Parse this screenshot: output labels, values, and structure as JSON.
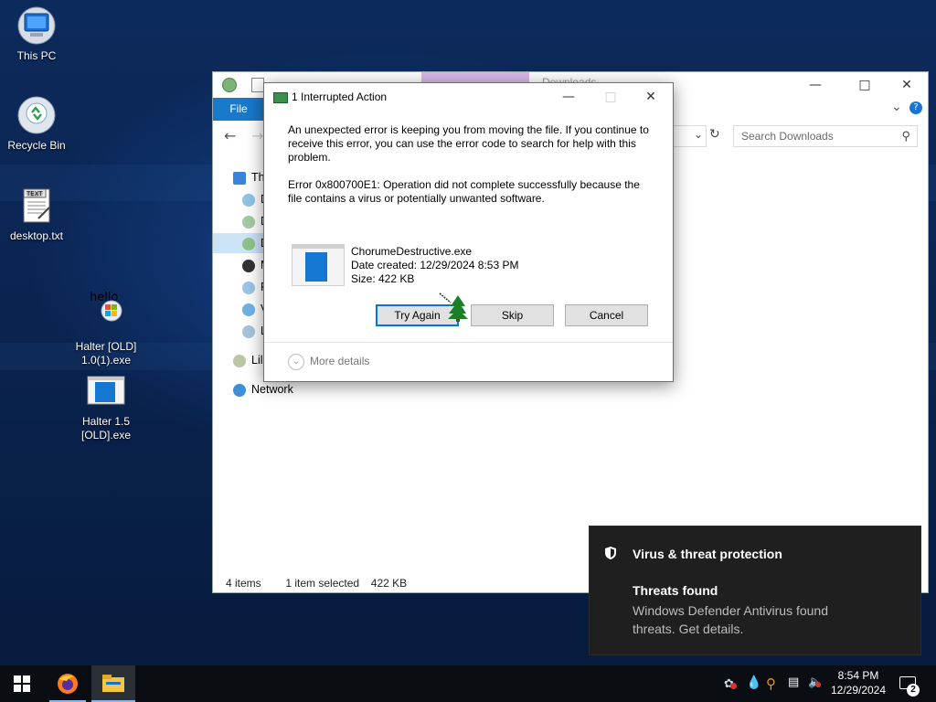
{
  "desktop": {
    "icons": [
      {
        "label": "This PC",
        "icon": "computer-icon"
      },
      {
        "label": "Recycle Bin",
        "icon": "recycle-bin-icon"
      },
      {
        "label": "desktop.txt",
        "icon": "text-file-icon"
      },
      {
        "label": "Halter [OLD] 1.0(1).exe",
        "icon": "installer-icon"
      },
      {
        "label": "Halter 1.5 [OLD].exe",
        "icon": "exe-file-icon"
      }
    ],
    "overlay_text": "hello"
  },
  "explorer": {
    "title_fragment": "Downloads",
    "file_tab": "File",
    "search_placeholder": "Search Downloads",
    "nav": {
      "group_initial": "Th",
      "items": [
        "D",
        "D",
        "D",
        "M",
        "P",
        "V",
        "L"
      ],
      "libraries": "Lil",
      "network": "Network"
    },
    "status": {
      "items": "4 items",
      "selected": "1 item selected",
      "size": "422 KB"
    }
  },
  "dialog": {
    "title": "1 Interrupted Action",
    "message": "An unexpected error is keeping you from moving the file. If you continue to receive this error, you can use the error code to search for help with this problem.",
    "error": "Error 0x800700E1: Operation did not complete successfully because the file contains a virus or potentially unwanted software.",
    "file": {
      "name": "ChorumeDestructive.exe",
      "date_created": "Date created: 12/29/2024 8:53 PM",
      "size": "Size: 422 KB"
    },
    "buttons": {
      "try_again": "Try Again",
      "skip": "Skip",
      "cancel": "Cancel"
    },
    "more_details": "More details"
  },
  "toast": {
    "app": "Virus & threat protection",
    "title": "Threats found",
    "body": "Windows Defender Antivirus found threats. Get details."
  },
  "taskbar": {
    "time": "8:54 PM",
    "date": "12/29/2024",
    "notification_count": "2"
  },
  "colors": {
    "accent": "#0078d7",
    "file_tab": "#1979ca",
    "toast_bg": "#1f1f1f",
    "taskbar_bg": "#0a0d12"
  }
}
